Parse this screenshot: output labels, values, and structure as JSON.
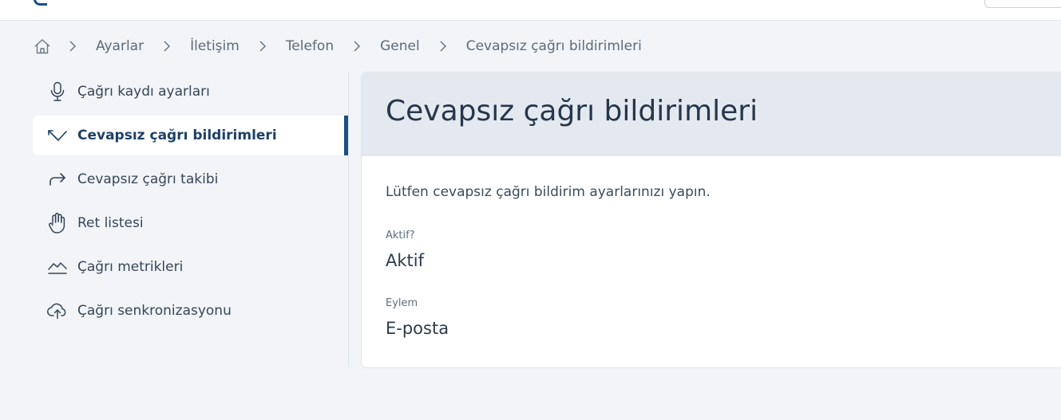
{
  "breadcrumb": {
    "home_icon": "home-icon",
    "items": [
      "Ayarlar",
      "İletişim",
      "Telefon",
      "Genel",
      "Cevapsız çağrı bildirimleri"
    ]
  },
  "sidebar": {
    "items": [
      {
        "label": "Çağrı kaydı ayarları",
        "icon": "microphone-icon",
        "active": false
      },
      {
        "label": "Cevapsız çağrı bildirimleri",
        "icon": "missed-call-icon",
        "active": true
      },
      {
        "label": "Cevapsız çağrı takibi",
        "icon": "forward-arrow-icon",
        "active": false
      },
      {
        "label": "Ret listesi",
        "icon": "hand-stop-icon",
        "active": false
      },
      {
        "label": "Çağrı metrikleri",
        "icon": "line-chart-icon",
        "active": false
      },
      {
        "label": "Çağrı senkronizasyonu",
        "icon": "cloud-upload-icon",
        "active": false
      }
    ]
  },
  "panel": {
    "title": "Cevapsız çağrı bildirimleri",
    "intro": "Lütfen cevapsız çağrı bildirim ayarlarınızı yapın.",
    "fields": [
      {
        "label": "Aktif?",
        "value": "Aktif"
      },
      {
        "label": "Eylem",
        "value": "E-posta"
      }
    ]
  },
  "colors": {
    "accent": "#1f4e80",
    "page_bg": "#f2f4f7",
    "header_bg": "#e4e9f0"
  }
}
